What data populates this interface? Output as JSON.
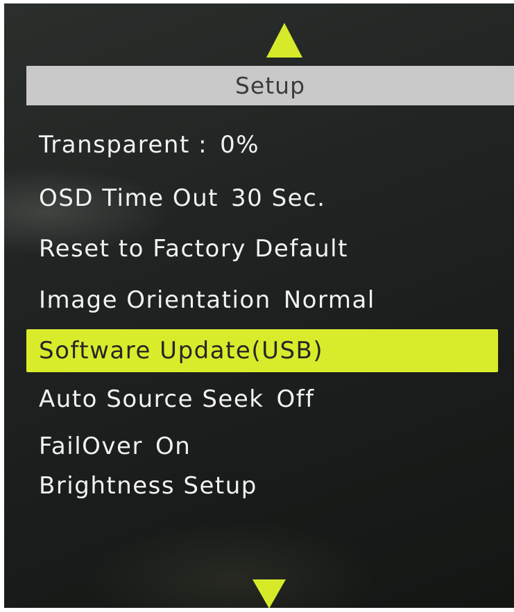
{
  "osd": {
    "title": "Setup",
    "nav": {
      "up_icon": "triangle-up-icon",
      "down_icon": "triangle-down-icon"
    },
    "items": [
      {
        "label": "Transparent :",
        "value": "0%"
      },
      {
        "label": "OSD Time Out",
        "value": "30 Sec."
      },
      {
        "label": "Reset to Factory Default",
        "value": ""
      },
      {
        "label": "Image Orientation",
        "value": "Normal"
      },
      {
        "label": "Software Update(USB)",
        "value": "",
        "selected": true
      },
      {
        "label": "Auto Source Seek",
        "value": "Off"
      },
      {
        "label": "FailOver",
        "value": "On"
      },
      {
        "label": "Brightness Setup",
        "value": ""
      }
    ]
  },
  "colors": {
    "highlight": "#d9ec2c",
    "arrow": "#d6ea2a",
    "header_bg": "#c9c9c9",
    "text": "#f2f2f2"
  }
}
